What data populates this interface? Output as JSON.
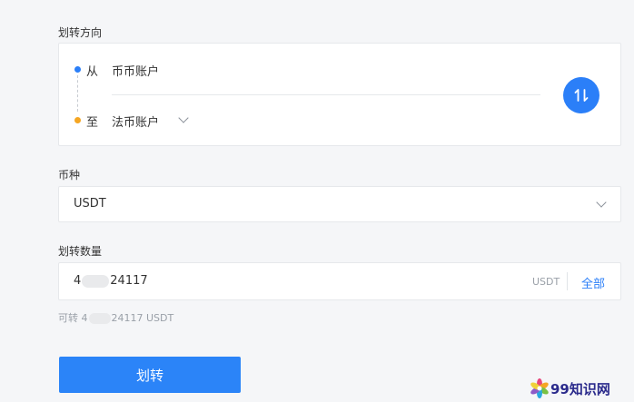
{
  "direction": {
    "label": "划转方向",
    "from_word": "从",
    "from_account": "币币账户",
    "to_word": "至",
    "to_account": "法币账户"
  },
  "coin": {
    "label": "币种",
    "value": "USDT"
  },
  "amount": {
    "label": "划转数量",
    "value_prefix": "4",
    "value_suffix": "24117",
    "unit": "USDT",
    "all_label": "全部",
    "available_prefix": "可转 4",
    "available_suffix": "24117 USDT"
  },
  "submit_label": "划转",
  "watermark": "99知识网",
  "colors": {
    "accent": "#2b7ff8",
    "from_dot": "#2b7ff8",
    "to_dot": "#f5a623"
  },
  "icons": {
    "swap": "swap-vertical-arrows-icon",
    "dropdown": "chevron-down-icon",
    "watermark_logo": "flower-logo-icon"
  }
}
